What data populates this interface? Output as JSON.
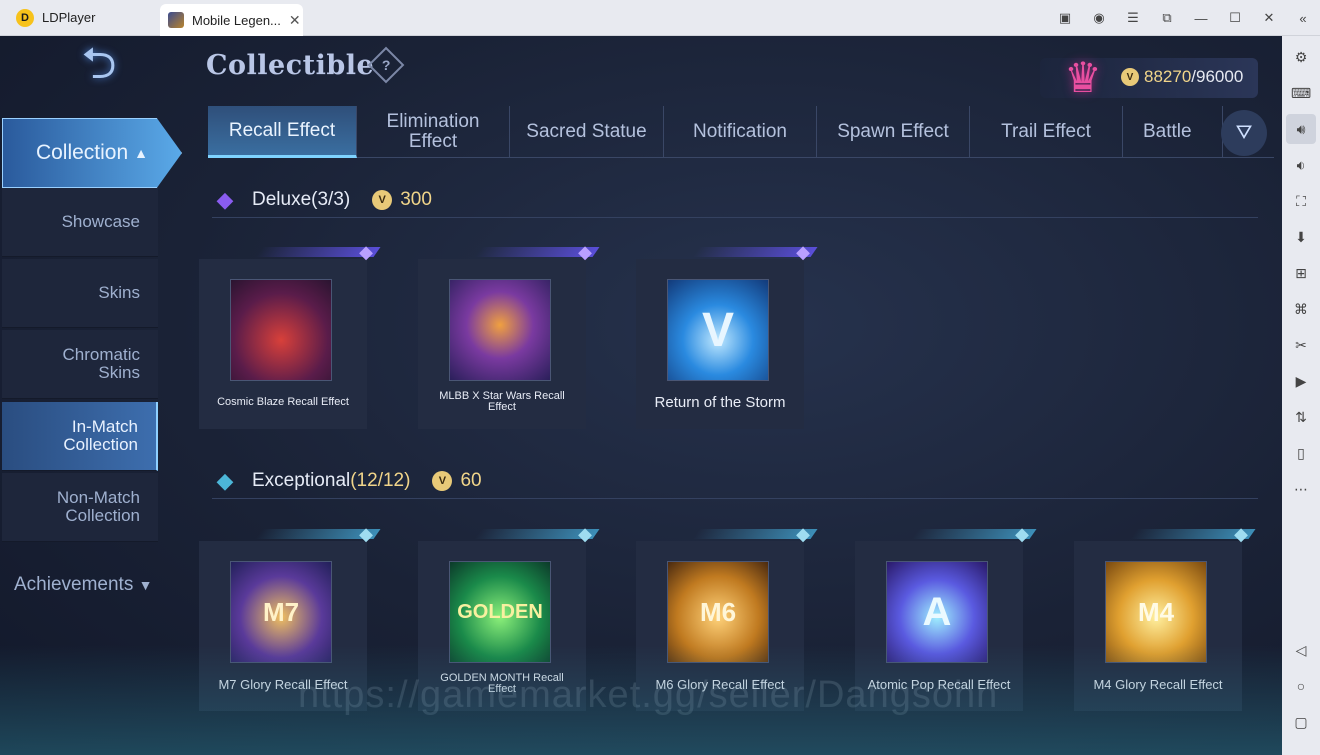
{
  "window": {
    "app_name": "LDPlayer",
    "tab_title": "Mobile Legen...",
    "tab_close": "✕"
  },
  "header": {
    "title": "Collectible",
    "help": "?",
    "points_current": "88270",
    "points_total": "/96000"
  },
  "sidebar": {
    "main_label": "Collection",
    "items": [
      {
        "label": "Showcase"
      },
      {
        "label": "Skins"
      },
      {
        "label": "Chromatic Skins"
      },
      {
        "label": "In-Match Collection"
      },
      {
        "label": "Non-Match Collection"
      }
    ],
    "achievements": "Achievements"
  },
  "tabs": [
    {
      "label": "Recall Effect"
    },
    {
      "label": "Elimination Effect"
    },
    {
      "label": "Sacred Statue"
    },
    {
      "label": "Notification"
    },
    {
      "label": "Spawn Effect"
    },
    {
      "label": "Trail Effect"
    },
    {
      "label": "Battle"
    }
  ],
  "sections": {
    "deluxe": {
      "title": "Deluxe(3/3)",
      "price": "300",
      "items": [
        {
          "label": "Cosmic Blaze Recall Effect"
        },
        {
          "label": "MLBB X Star Wars Recall Effect"
        },
        {
          "label": "Return of the Storm"
        }
      ]
    },
    "exceptional": {
      "title_main": "Exceptional",
      "title_count": "(12/12)",
      "price": "60",
      "items": [
        {
          "label": "M7 Glory Recall Effect",
          "badge": "M7"
        },
        {
          "label": "GOLDEN MONTH Recall Effect",
          "badge": "GOLDEN"
        },
        {
          "label": "M6 Glory Recall Effect",
          "badge": "M6"
        },
        {
          "label": "Atomic Pop Recall Effect",
          "badge": "A"
        },
        {
          "label": "M4 Glory Recall Effect",
          "badge": "M4"
        }
      ]
    }
  },
  "watermark": "https://gamemarket.gg/seller/Dangsohn",
  "colors": {
    "accent": "#5aa9e8",
    "gold": "#f1d58a",
    "deluxe_gem": "#8a5cf0",
    "exceptional_gem": "#4cb6d8"
  }
}
